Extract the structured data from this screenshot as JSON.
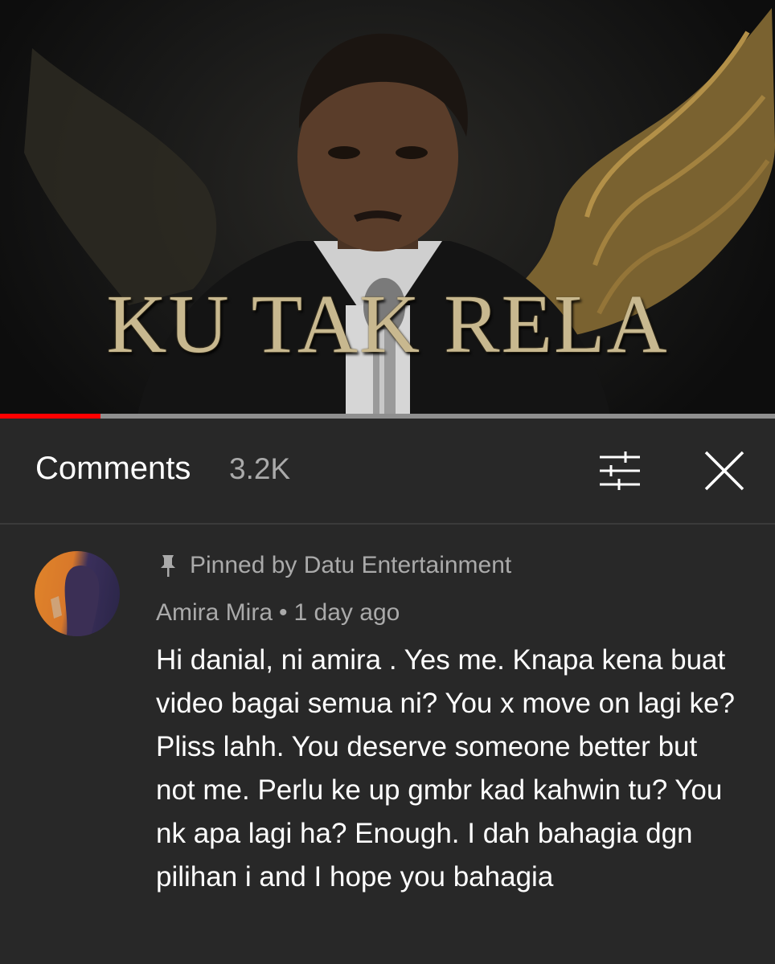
{
  "video": {
    "title": "KU TAK RELA",
    "progress_fraction": 0.13
  },
  "header": {
    "title": "Comments",
    "count": "3.2K",
    "sort_icon": "sort-filter-icon",
    "close_icon": "close-icon"
  },
  "comment": {
    "pinned_label": "Pinned by Datu Entertainment",
    "author": "Amira Mira",
    "separator": "•",
    "time": "1 day ago",
    "text": "Hi danial, ni amira . Yes me. Knapa kena buat video bagai semua ni? You x move on lagi ke? Pliss lahh. You deserve someone better but not me. Perlu ke up gmbr kad kahwin tu? You nk apa lagi ha? Enough. I dah bahagia dgn pilihan i and I hope you bahagia"
  },
  "colors": {
    "background": "#282828",
    "progress": "#ff0000",
    "secondary_text": "#aaaaaa",
    "primary_text": "#ffffff"
  }
}
